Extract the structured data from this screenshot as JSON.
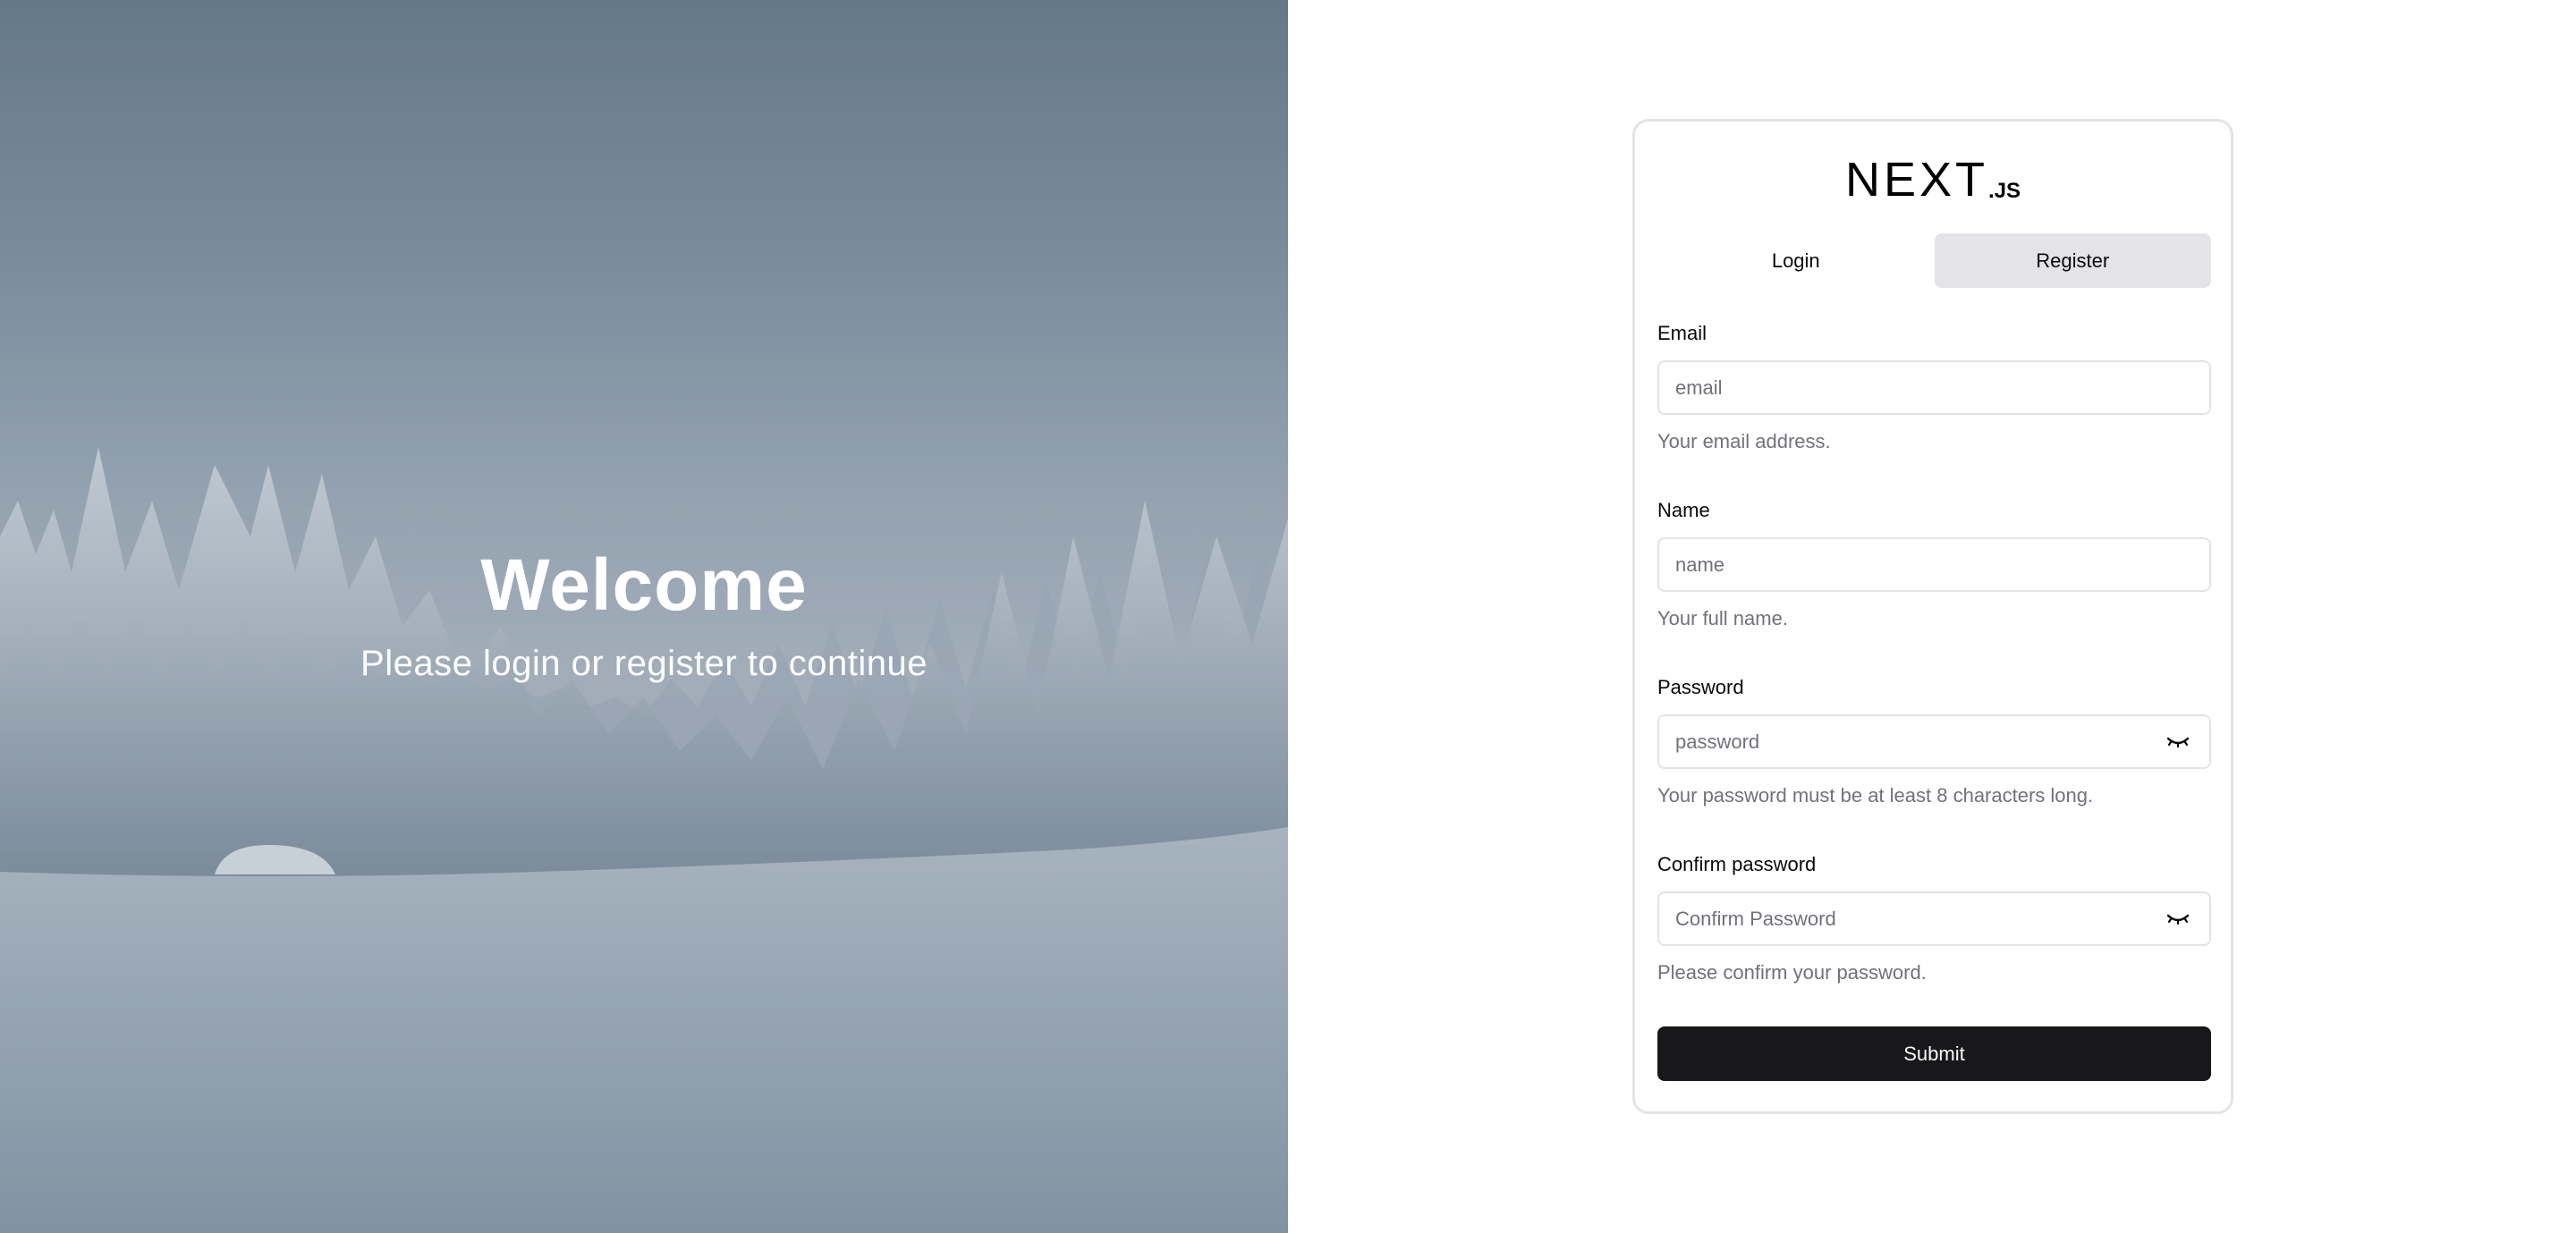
{
  "hero": {
    "title": "Welcome",
    "subtitle": "Please login or register to continue"
  },
  "logo": {
    "main": "NEXT",
    "suffix": ".JS"
  },
  "tabs": [
    {
      "label": "Login",
      "active": false
    },
    {
      "label": "Register",
      "active": true
    }
  ],
  "form": {
    "email": {
      "label": "Email",
      "placeholder": "email",
      "help": "Your email address."
    },
    "name": {
      "label": "Name",
      "placeholder": "name",
      "help": "Your full name."
    },
    "password": {
      "label": "Password",
      "placeholder": "password",
      "help": "Your password must be at least 8 characters long.",
      "icon": "eye-closed-icon"
    },
    "confirm": {
      "label": "Confirm password",
      "placeholder": "Confirm Password",
      "help": "Please confirm your password.",
      "icon": "eye-closed-icon"
    },
    "submit_label": "Submit"
  },
  "colors": {
    "primary": "#18181b",
    "muted": "#71717a",
    "border": "#e4e4e7",
    "tab_active": "#e4e4e7"
  }
}
